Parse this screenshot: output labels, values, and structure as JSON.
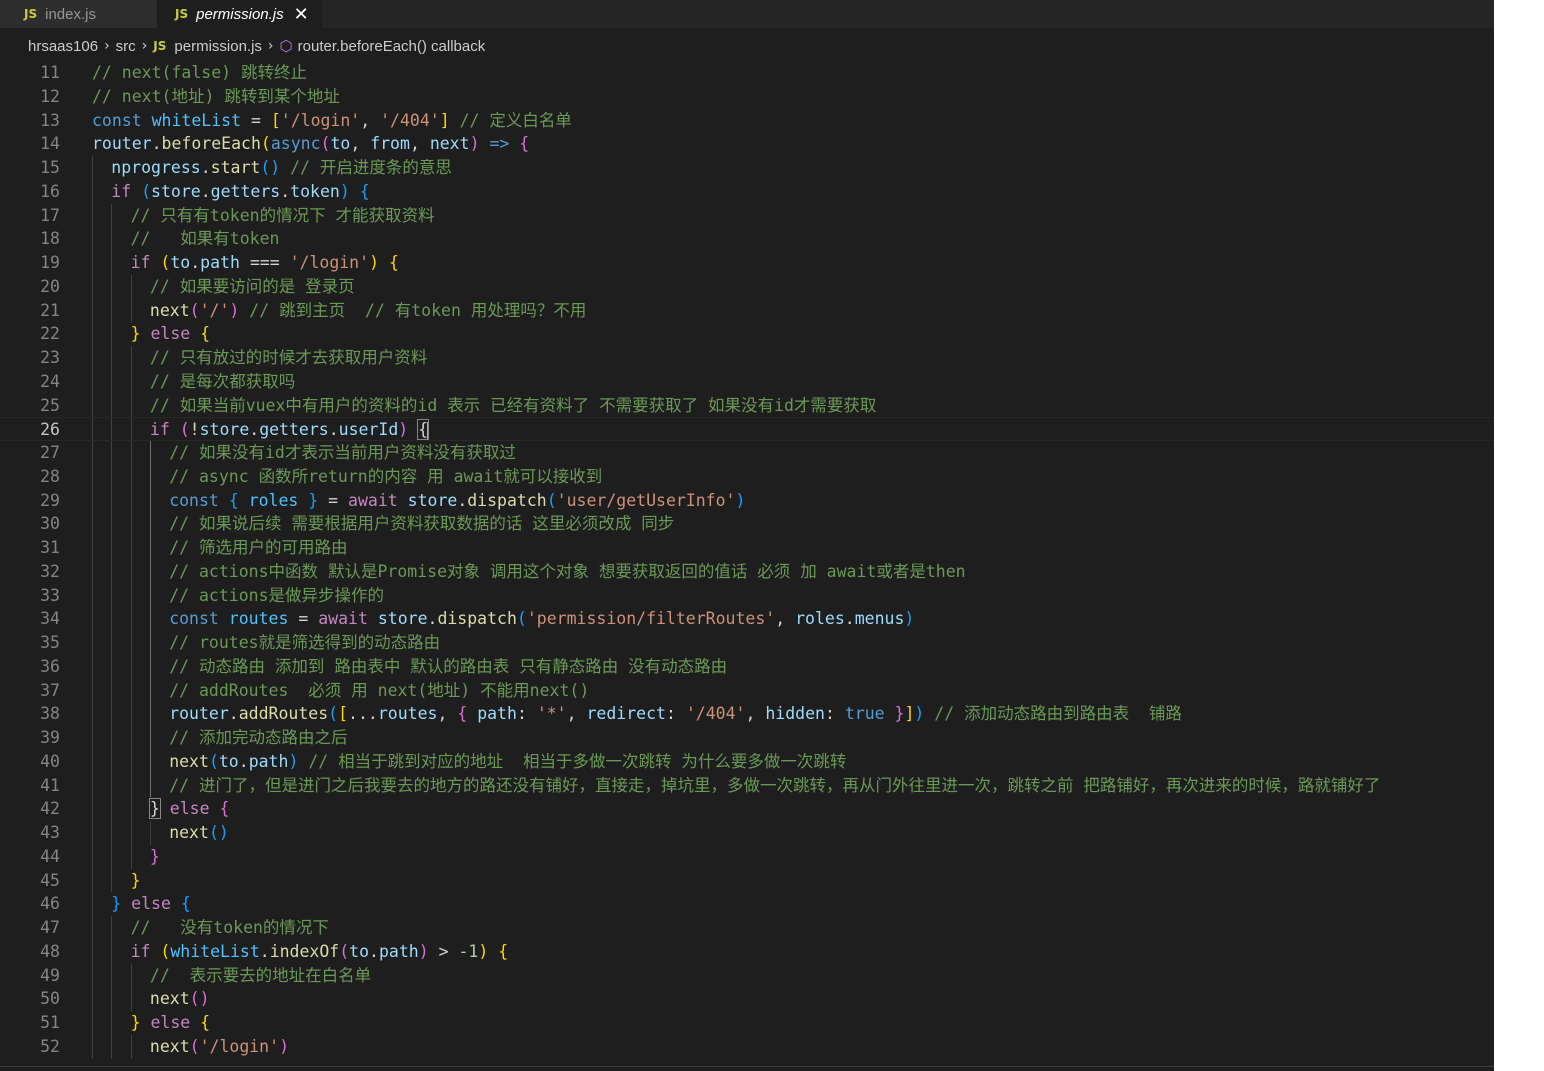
{
  "tabs": [
    {
      "icon": "JS",
      "label": "index.js",
      "active": false
    },
    {
      "icon": "JS",
      "label": "permission.js",
      "active": true,
      "close": "✕"
    }
  ],
  "breadcrumb": {
    "parts": [
      "hrsaas106",
      "src",
      "permission.js",
      "router.beforeEach() callback"
    ],
    "separator": "›",
    "file_icon": "JS"
  },
  "colors": {
    "background": "#1e1e1e",
    "keyword": "#569cd6",
    "control": "#c586c0",
    "variable": "#9cdcfe",
    "constant": "#4fc1ff",
    "function": "#dcdcaa",
    "string": "#ce9178",
    "comment": "#6a9955",
    "number": "#b5cea8",
    "bracket1": "#ffd700",
    "bracket2": "#da70d6",
    "bracket3": "#179fff",
    "line_number": "#858585"
  },
  "editor": {
    "current_line": 26,
    "lines": [
      {
        "n": "11",
        "indent": 0,
        "tokens": [
          [
            "cmt",
            "// next(false) 跳转终止"
          ]
        ]
      },
      {
        "n": "12",
        "indent": 0,
        "tokens": [
          [
            "cmt",
            "// next(地址) 跳转到某个地址"
          ]
        ]
      },
      {
        "n": "13",
        "indent": 0,
        "tokens": [
          [
            "kw",
            "const "
          ],
          [
            "const",
            "whiteList"
          ],
          [
            "op",
            " = "
          ],
          [
            "b1",
            "["
          ],
          [
            "str",
            "'/login'"
          ],
          [
            "op",
            ", "
          ],
          [
            "str",
            "'/404'"
          ],
          [
            "b1",
            "]"
          ],
          [
            "op",
            " "
          ],
          [
            "cmt",
            "// 定义白名单"
          ]
        ]
      },
      {
        "n": "14",
        "indent": 0,
        "tokens": [
          [
            "var",
            "router"
          ],
          [
            "op",
            "."
          ],
          [
            "fn",
            "beforeEach"
          ],
          [
            "b1",
            "("
          ],
          [
            "kw",
            "async"
          ],
          [
            "b2",
            "("
          ],
          [
            "var",
            "to"
          ],
          [
            "op",
            ", "
          ],
          [
            "var",
            "from"
          ],
          [
            "op",
            ", "
          ],
          [
            "var",
            "next"
          ],
          [
            "b2",
            ")"
          ],
          [
            "op",
            " "
          ],
          [
            "kw",
            "=>"
          ],
          [
            "op",
            " "
          ],
          [
            "b2",
            "{"
          ]
        ]
      },
      {
        "n": "15",
        "indent": 1,
        "tokens": [
          [
            "var",
            "nprogress"
          ],
          [
            "op",
            "."
          ],
          [
            "fn",
            "start"
          ],
          [
            "b3",
            "()"
          ],
          [
            "op",
            " "
          ],
          [
            "cmt",
            "// 开启进度条的意思"
          ]
        ]
      },
      {
        "n": "16",
        "indent": 1,
        "tokens": [
          [
            "ctl",
            "if"
          ],
          [
            "op",
            " "
          ],
          [
            "b3",
            "("
          ],
          [
            "var",
            "store"
          ],
          [
            "op",
            "."
          ],
          [
            "var",
            "getters"
          ],
          [
            "op",
            "."
          ],
          [
            "var",
            "token"
          ],
          [
            "b3",
            ")"
          ],
          [
            "op",
            " "
          ],
          [
            "b3",
            "{"
          ]
        ]
      },
      {
        "n": "17",
        "indent": 2,
        "tokens": [
          [
            "cmt",
            "// 只有有token的情况下 才能获取资料"
          ]
        ]
      },
      {
        "n": "18",
        "indent": 2,
        "tokens": [
          [
            "cmt",
            "//   如果有token"
          ]
        ]
      },
      {
        "n": "19",
        "indent": 2,
        "tokens": [
          [
            "ctl",
            "if"
          ],
          [
            "op",
            " "
          ],
          [
            "b1",
            "("
          ],
          [
            "var",
            "to"
          ],
          [
            "op",
            "."
          ],
          [
            "var",
            "path"
          ],
          [
            "op",
            " === "
          ],
          [
            "str",
            "'/login'"
          ],
          [
            "b1",
            ")"
          ],
          [
            "op",
            " "
          ],
          [
            "b1",
            "{"
          ]
        ]
      },
      {
        "n": "20",
        "indent": 3,
        "tokens": [
          [
            "cmt",
            "// 如果要访问的是 登录页"
          ]
        ]
      },
      {
        "n": "21",
        "indent": 3,
        "tokens": [
          [
            "fn",
            "next"
          ],
          [
            "b2",
            "("
          ],
          [
            "str",
            "'/'"
          ],
          [
            "b2",
            ")"
          ],
          [
            "op",
            " "
          ],
          [
            "cmt",
            "// 跳到主页  // 有token 用处理吗？不用"
          ]
        ]
      },
      {
        "n": "22",
        "indent": 2,
        "tokens": [
          [
            "b1",
            "}"
          ],
          [
            "op",
            " "
          ],
          [
            "ctl",
            "else"
          ],
          [
            "op",
            " "
          ],
          [
            "b1",
            "{"
          ]
        ]
      },
      {
        "n": "23",
        "indent": 3,
        "tokens": [
          [
            "cmt",
            "// 只有放过的时候才去获取用户资料"
          ]
        ]
      },
      {
        "n": "24",
        "indent": 3,
        "tokens": [
          [
            "cmt",
            "// 是每次都获取吗"
          ]
        ]
      },
      {
        "n": "25",
        "indent": 3,
        "tokens": [
          [
            "cmt",
            "// 如果当前vuex中有用户的资料的id 表示 已经有资料了 不需要获取了 如果没有id才需要获取"
          ]
        ]
      },
      {
        "n": "26",
        "indent": 3,
        "tokens": [
          [
            "ctl",
            "if"
          ],
          [
            "op",
            " "
          ],
          [
            "b2",
            "("
          ],
          [
            "op",
            "!"
          ],
          [
            "var",
            "store"
          ],
          [
            "op",
            "."
          ],
          [
            "var",
            "getters"
          ],
          [
            "op",
            "."
          ],
          [
            "var",
            "userId"
          ],
          [
            "b2",
            ")"
          ],
          [
            "op",
            " "
          ],
          [
            "bm",
            "{"
          ]
        ]
      },
      {
        "n": "27",
        "indent": 4,
        "tokens": [
          [
            "cmt",
            "// 如果没有id才表示当前用户资料没有获取过"
          ]
        ]
      },
      {
        "n": "28",
        "indent": 4,
        "tokens": [
          [
            "cmt",
            "// async 函数所return的内容 用 await就可以接收到"
          ]
        ]
      },
      {
        "n": "29",
        "indent": 4,
        "tokens": [
          [
            "kw",
            "const"
          ],
          [
            "op",
            " "
          ],
          [
            "b3",
            "{"
          ],
          [
            "op",
            " "
          ],
          [
            "const",
            "roles"
          ],
          [
            "op",
            " "
          ],
          [
            "b3",
            "}"
          ],
          [
            "op",
            " = "
          ],
          [
            "ctl",
            "await"
          ],
          [
            "op",
            " "
          ],
          [
            "var",
            "store"
          ],
          [
            "op",
            "."
          ],
          [
            "fn",
            "dispatch"
          ],
          [
            "b3",
            "("
          ],
          [
            "str",
            "'user/getUserInfo'"
          ],
          [
            "b3",
            ")"
          ]
        ]
      },
      {
        "n": "30",
        "indent": 4,
        "tokens": [
          [
            "cmt",
            "// 如果说后续 需要根据用户资料获取数据的话 这里必须改成 同步"
          ]
        ]
      },
      {
        "n": "31",
        "indent": 4,
        "tokens": [
          [
            "cmt",
            "// 筛选用户的可用路由"
          ]
        ]
      },
      {
        "n": "32",
        "indent": 4,
        "tokens": [
          [
            "cmt",
            "// actions中函数 默认是Promise对象 调用这个对象 想要获取返回的值话 必须 加 await或者是then"
          ]
        ]
      },
      {
        "n": "33",
        "indent": 4,
        "tokens": [
          [
            "cmt",
            "// actions是做异步操作的"
          ]
        ]
      },
      {
        "n": "34",
        "indent": 4,
        "tokens": [
          [
            "kw",
            "const"
          ],
          [
            "op",
            " "
          ],
          [
            "const",
            "routes"
          ],
          [
            "op",
            " = "
          ],
          [
            "ctl",
            "await"
          ],
          [
            "op",
            " "
          ],
          [
            "var",
            "store"
          ],
          [
            "op",
            "."
          ],
          [
            "fn",
            "dispatch"
          ],
          [
            "b3",
            "("
          ],
          [
            "str",
            "'permission/filterRoutes'"
          ],
          [
            "op",
            ", "
          ],
          [
            "var",
            "roles"
          ],
          [
            "op",
            "."
          ],
          [
            "var",
            "menus"
          ],
          [
            "b3",
            ")"
          ]
        ]
      },
      {
        "n": "35",
        "indent": 4,
        "tokens": [
          [
            "cmt",
            "// routes就是筛选得到的动态路由"
          ]
        ]
      },
      {
        "n": "36",
        "indent": 4,
        "tokens": [
          [
            "cmt",
            "// 动态路由 添加到 路由表中 默认的路由表 只有静态路由 没有动态路由"
          ]
        ]
      },
      {
        "n": "37",
        "indent": 4,
        "tokens": [
          [
            "cmt",
            "// addRoutes  必须 用 next(地址) 不能用next()"
          ]
        ]
      },
      {
        "n": "38",
        "indent": 4,
        "tokens": [
          [
            "var",
            "router"
          ],
          [
            "op",
            "."
          ],
          [
            "fn",
            "addRoutes"
          ],
          [
            "b3",
            "("
          ],
          [
            "b1",
            "["
          ],
          [
            "op",
            "..."
          ],
          [
            "var",
            "routes"
          ],
          [
            "op",
            ", "
          ],
          [
            "b2",
            "{"
          ],
          [
            "op",
            " "
          ],
          [
            "var",
            "path"
          ],
          [
            "op",
            ": "
          ],
          [
            "str",
            "'*'"
          ],
          [
            "op",
            ", "
          ],
          [
            "var",
            "redirect"
          ],
          [
            "op",
            ": "
          ],
          [
            "str",
            "'/404'"
          ],
          [
            "op",
            ", "
          ],
          [
            "var",
            "hidden"
          ],
          [
            "op",
            ": "
          ],
          [
            "kw",
            "true"
          ],
          [
            "op",
            " "
          ],
          [
            "b2",
            "}"
          ],
          [
            "b1",
            "]"
          ],
          [
            "b3",
            ")"
          ],
          [
            "op",
            " "
          ],
          [
            "cmt",
            "// 添加动态路由到路由表  铺路"
          ]
        ]
      },
      {
        "n": "39",
        "indent": 4,
        "tokens": [
          [
            "cmt",
            "// 添加完动态路由之后"
          ]
        ]
      },
      {
        "n": "40",
        "indent": 4,
        "tokens": [
          [
            "fn",
            "next"
          ],
          [
            "b3",
            "("
          ],
          [
            "var",
            "to"
          ],
          [
            "op",
            "."
          ],
          [
            "var",
            "path"
          ],
          [
            "b3",
            ")"
          ],
          [
            "op",
            " "
          ],
          [
            "cmt",
            "// 相当于跳到对应的地址  相当于多做一次跳转 为什么要多做一次跳转"
          ]
        ]
      },
      {
        "n": "41",
        "indent": 4,
        "tokens": [
          [
            "cmt",
            "// 进门了，但是进门之后我要去的地方的路还没有铺好，直接走，掉坑里，多做一次跳转，再从门外往里进一次，跳转之前 把路铺好，再次进来的时候，路就铺好了"
          ]
        ]
      },
      {
        "n": "42",
        "indent": 3,
        "tokens": [
          [
            "bm",
            "}"
          ],
          [
            "op",
            " "
          ],
          [
            "ctl",
            "else"
          ],
          [
            "op",
            " "
          ],
          [
            "b2",
            "{"
          ]
        ]
      },
      {
        "n": "43",
        "indent": 4,
        "tokens": [
          [
            "fn",
            "next"
          ],
          [
            "b3",
            "()"
          ]
        ]
      },
      {
        "n": "44",
        "indent": 3,
        "tokens": [
          [
            "b2",
            "}"
          ]
        ]
      },
      {
        "n": "45",
        "indent": 2,
        "tokens": [
          [
            "b1",
            "}"
          ]
        ]
      },
      {
        "n": "46",
        "indent": 1,
        "tokens": [
          [
            "b3",
            "}"
          ],
          [
            "op",
            " "
          ],
          [
            "ctl",
            "else"
          ],
          [
            "op",
            " "
          ],
          [
            "b3",
            "{"
          ]
        ]
      },
      {
        "n": "47",
        "indent": 2,
        "tokens": [
          [
            "cmt",
            "//   没有token的情况下"
          ]
        ]
      },
      {
        "n": "48",
        "indent": 2,
        "tokens": [
          [
            "ctl",
            "if"
          ],
          [
            "op",
            " "
          ],
          [
            "b1",
            "("
          ],
          [
            "const",
            "whiteList"
          ],
          [
            "op",
            "."
          ],
          [
            "fn",
            "indexOf"
          ],
          [
            "b2",
            "("
          ],
          [
            "var",
            "to"
          ],
          [
            "op",
            "."
          ],
          [
            "var",
            "path"
          ],
          [
            "b2",
            ")"
          ],
          [
            "op",
            " > "
          ],
          [
            "num",
            "-1"
          ],
          [
            "b1",
            ")"
          ],
          [
            "op",
            " "
          ],
          [
            "b1",
            "{"
          ]
        ]
      },
      {
        "n": "49",
        "indent": 3,
        "tokens": [
          [
            "cmt",
            "//  表示要去的地址在白名单"
          ]
        ]
      },
      {
        "n": "50",
        "indent": 3,
        "tokens": [
          [
            "fn",
            "next"
          ],
          [
            "b2",
            "()"
          ]
        ]
      },
      {
        "n": "51",
        "indent": 2,
        "tokens": [
          [
            "b1",
            "}"
          ],
          [
            "op",
            " "
          ],
          [
            "ctl",
            "else"
          ],
          [
            "op",
            " "
          ],
          [
            "b1",
            "{"
          ]
        ]
      },
      {
        "n": "52",
        "indent": 3,
        "tokens": [
          [
            "fn",
            "next"
          ],
          [
            "b2",
            "("
          ],
          [
            "str",
            "'/login'"
          ],
          [
            "b2",
            ")"
          ]
        ]
      }
    ]
  }
}
